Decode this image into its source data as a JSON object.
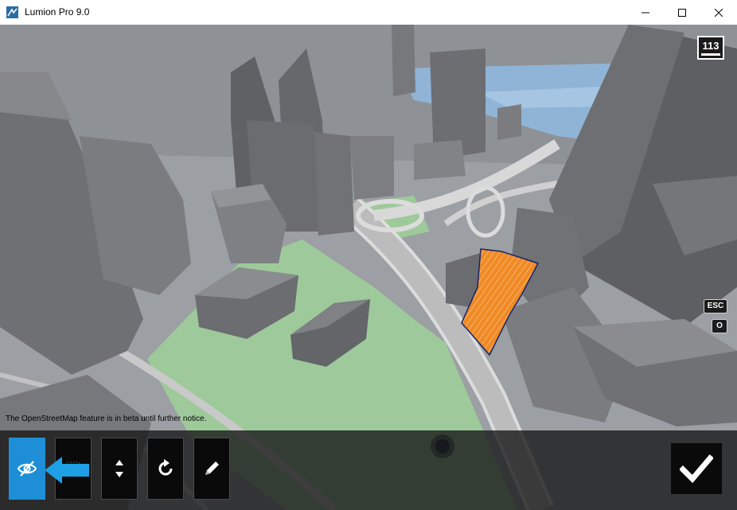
{
  "window": {
    "title": "Lumion Pro 9.0",
    "controls": [
      "minimize",
      "maximize",
      "close"
    ]
  },
  "viewport": {
    "fps": "113",
    "keys": {
      "escape": "ESC",
      "orbit": "O"
    },
    "beta_notice": "The OpenStreetMap feature is in beta until further notice.",
    "selection_color": "#f08a24"
  },
  "toolbar": {
    "tools": [
      {
        "id": "visibility-toggle",
        "icon": "eye-slash-icon",
        "active": true
      },
      {
        "id": "select",
        "icon": "selection-box-icon",
        "active": false
      },
      {
        "id": "move-height",
        "icon": "up-down-arrows-icon",
        "active": false
      },
      {
        "id": "rotate",
        "icon": "rotate-icon",
        "active": false
      },
      {
        "id": "edit",
        "icon": "pencil-icon",
        "active": false
      }
    ],
    "confirm_icon": "checkmark-icon",
    "hint_arrow_color": "#1ea0e6",
    "active_color": "#1e8fd6"
  }
}
